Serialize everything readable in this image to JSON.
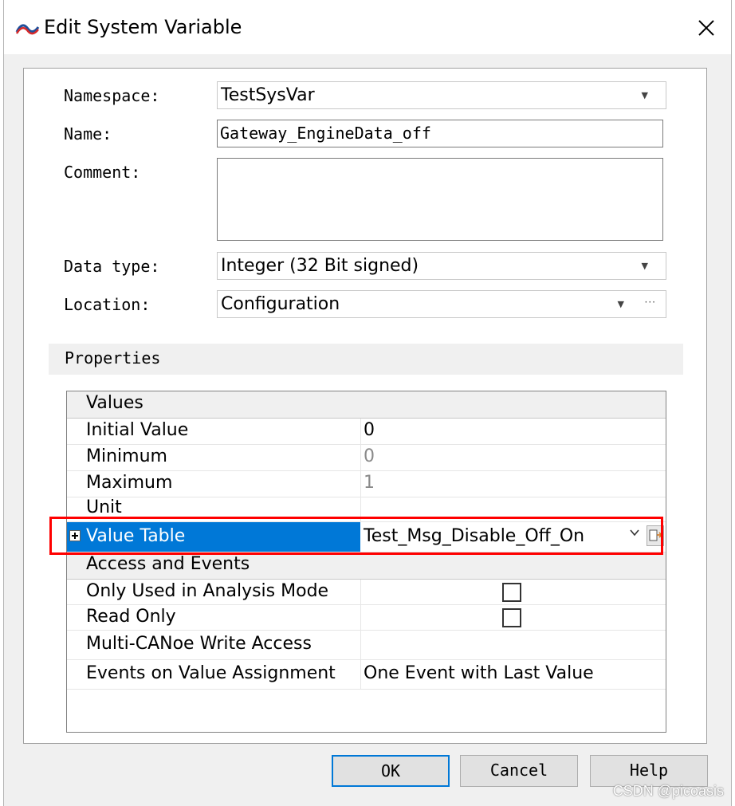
{
  "dialog": {
    "title": "Edit System Variable",
    "close_label": "Close"
  },
  "form": {
    "namespace_label": "Namespace:",
    "namespace_value": "TestSysVar",
    "name_label": "Name:",
    "name_value": "Gateway_EngineData_off",
    "comment_label": "Comment:",
    "comment_value": "",
    "datatype_label": "Data type:",
    "datatype_value": "Integer (32 Bit signed)",
    "location_label": "Location:",
    "location_value": "Configuration"
  },
  "properties": {
    "header": "Properties",
    "values_category": "Values",
    "initial_value_label": "Initial Value",
    "initial_value": "0",
    "minimum_label": "Minimum",
    "minimum_value": "0",
    "maximum_label": "Maximum",
    "maximum_value": "1",
    "unit_label": "Unit",
    "unit_value": "",
    "value_table_label": "Value Table",
    "value_table_value": "Test_Msg_Disable_Off_On",
    "access_category": "Access and Events",
    "analysis_mode_label": "Only Used in Analysis Mode",
    "analysis_mode_checked": false,
    "read_only_label": "Read Only",
    "read_only_checked": false,
    "multi_canoe_label": "Multi-CANoe Write Access",
    "multi_canoe_value": "",
    "events_label": "Events on Value Assignment",
    "events_value": "One Event with Last Value"
  },
  "buttons": {
    "ok": "OK",
    "cancel": "Cancel",
    "help": "Help"
  },
  "watermark": "CSDN @picoasis",
  "colors": {
    "selection": "#0078d7",
    "highlight_box": "#ff0000",
    "dialog_bg": "#f0f0f0"
  }
}
